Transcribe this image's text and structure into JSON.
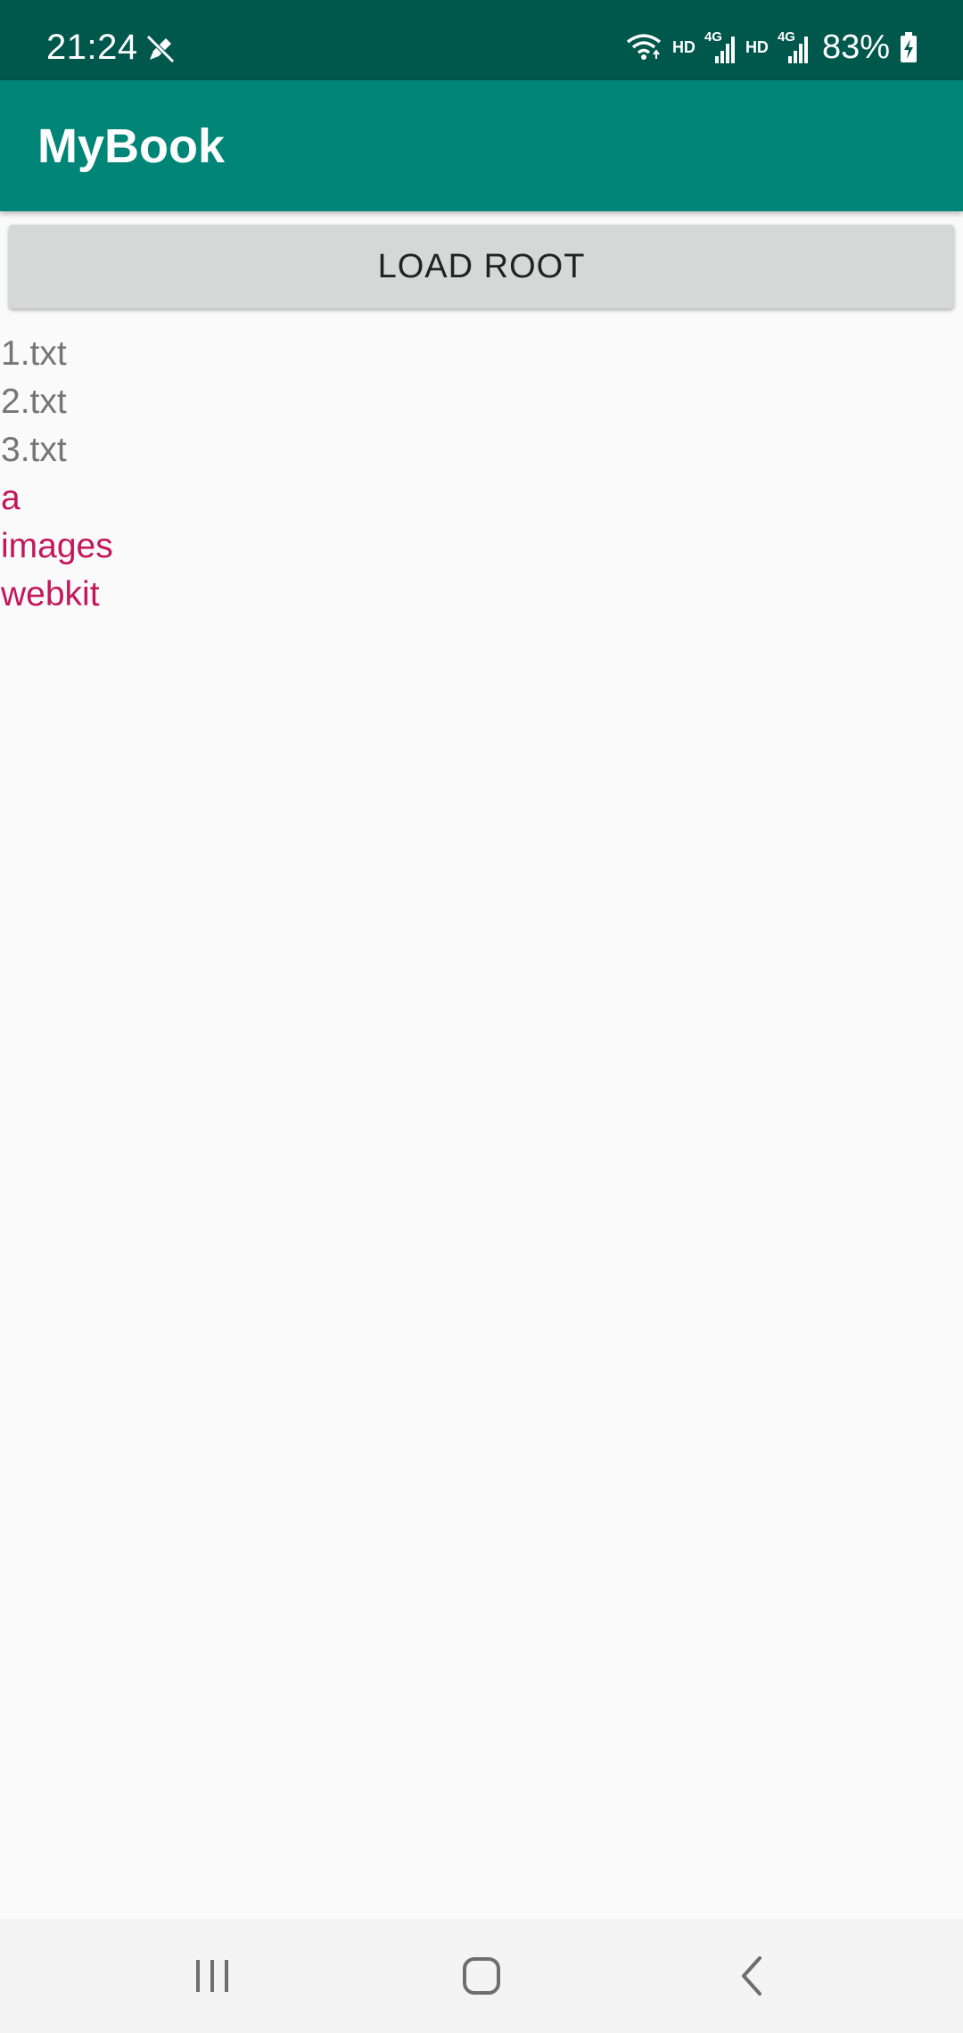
{
  "status_bar": {
    "time": "21:24",
    "left_icon": "pen-off-icon",
    "hd_1": "HD",
    "network_1": "4G",
    "hd_2": "HD",
    "network_2": "4G",
    "battery_percent": "83%",
    "icons": [
      "wifi-icon",
      "signal-icon",
      "signal-icon",
      "battery-charging-icon"
    ]
  },
  "app_bar": {
    "title": "MyBook"
  },
  "main": {
    "load_button_label": "LOAD ROOT",
    "entries": [
      {
        "name": "1.txt",
        "kind": "file"
      },
      {
        "name": "2.txt",
        "kind": "file"
      },
      {
        "name": "3.txt",
        "kind": "file"
      },
      {
        "name": "a",
        "kind": "folder"
      },
      {
        "name": "images",
        "kind": "folder"
      },
      {
        "name": "webkit",
        "kind": "folder"
      }
    ]
  },
  "nav_bar": {
    "buttons": [
      "recent-apps-icon",
      "home-icon",
      "back-icon"
    ]
  },
  "colors": {
    "status_bar": "#00574b",
    "app_bar": "#008577",
    "file_text": "#757575",
    "folder_text": "#c2185b",
    "button_bg": "#d6d7d7"
  }
}
